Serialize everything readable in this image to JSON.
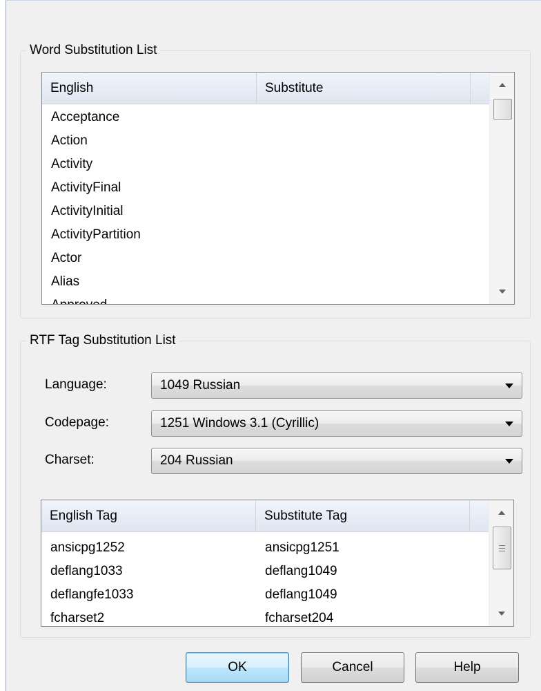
{
  "word_substitution": {
    "title": "Word Substitution List",
    "columns": [
      "English",
      "Substitute"
    ],
    "rows": [
      [
        "Acceptance",
        ""
      ],
      [
        "Action",
        ""
      ],
      [
        "Activity",
        ""
      ],
      [
        "ActivityFinal",
        ""
      ],
      [
        "ActivityInitial",
        ""
      ],
      [
        "ActivityPartition",
        ""
      ],
      [
        "Actor",
        ""
      ],
      [
        "Alias",
        ""
      ],
      [
        "Approved",
        ""
      ]
    ]
  },
  "rtf_substitution": {
    "title": "RTF Tag Substitution List",
    "language_label": "Language:",
    "language_value": "1049 Russian",
    "codepage_label": "Codepage:",
    "codepage_value": "1251 Windows 3.1 (Cyrillic)",
    "charset_label": "Charset:",
    "charset_value": "204 Russian",
    "columns": [
      "English Tag",
      "Substitute Tag"
    ],
    "rows": [
      [
        "ansicpg1252",
        "ansicpg1251"
      ],
      [
        "deflang1033",
        "deflang1049"
      ],
      [
        "deflangfe1033",
        "deflang1049"
      ],
      [
        "fcharset2",
        "fcharset204"
      ]
    ]
  },
  "buttons": {
    "ok": "OK",
    "cancel": "Cancel",
    "help": "Help"
  }
}
